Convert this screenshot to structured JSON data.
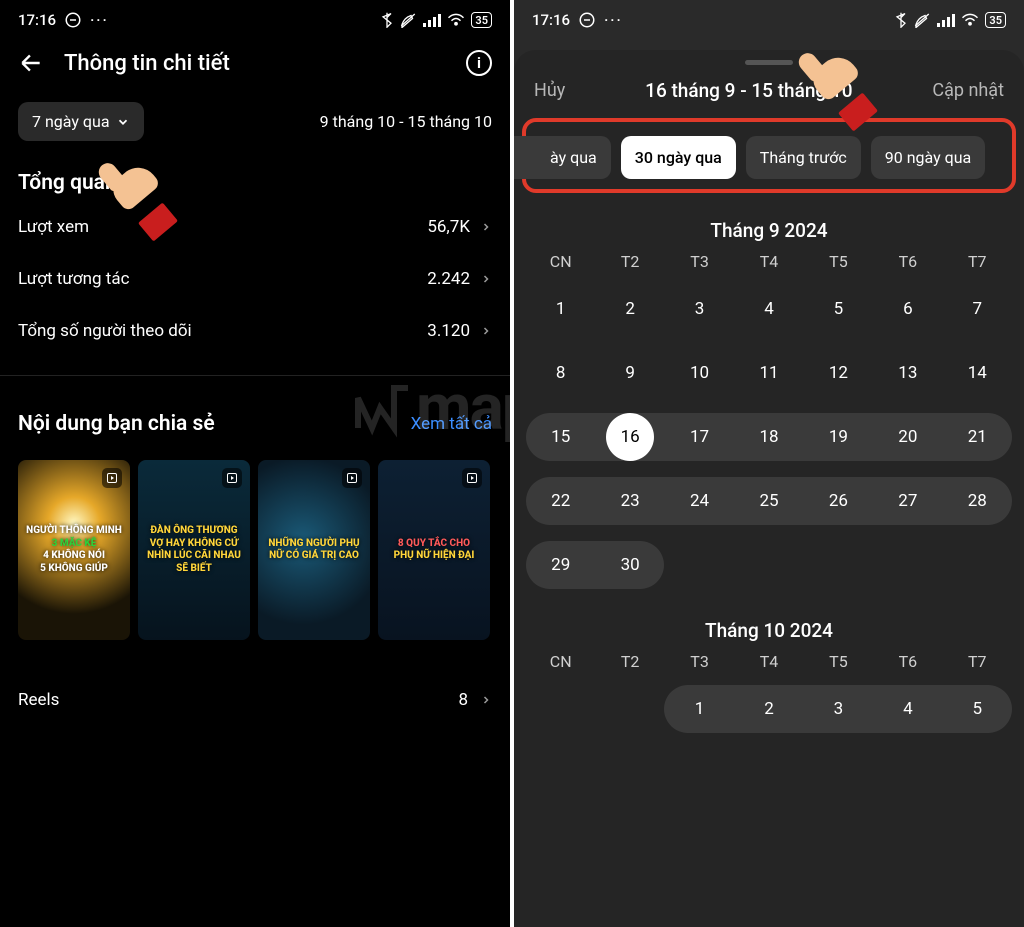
{
  "status": {
    "time": "17:16",
    "battery": "35"
  },
  "left": {
    "header_title": "Thông tin chi tiết",
    "range_chip": "7 ngày qua",
    "range_text": "9 tháng 10 - 15 tháng 10",
    "overview_title": "Tổng quan",
    "metrics": {
      "views_label": "Lượt xem",
      "views_value": "56,7K",
      "interactions_label": "Lượt tương tác",
      "interactions_value": "2.242",
      "followers_label": "Tổng số người theo dõi",
      "followers_value": "3.120"
    },
    "content_title": "Nội dung bạn chia sẻ",
    "see_all": "Xem tất cả",
    "thumbs": {
      "t1_l1": "NGƯỜI THÔNG MINH",
      "t1_l2": "3 MẶC KỆ",
      "t1_l3": "4 KHÔNG NÓI",
      "t1_l4": "5 KHÔNG GIÚP",
      "t2": "ĐÀN ÔNG THƯƠNG VỢ HAY KHÔNG CỨ NHÌN LÚC CÃI NHAU SẼ BIẾT",
      "t3": "NHỮNG NGƯỜI PHỤ NỮ CÓ GIÁ TRỊ CAO",
      "t4_l1": "8 QUY TẮC CHO",
      "t4_l2": "PHỤ NỮ HIỆN ĐẠI"
    },
    "reels_label": "Reels",
    "reels_value": "8"
  },
  "right": {
    "cancel": "Hủy",
    "range_title": "16 tháng 9 - 15 tháng 10",
    "update": "Cập nhật",
    "presets": {
      "p0": "ày qua",
      "p1": "30 ngày qua",
      "p2": "Tháng trước",
      "p3": "90 ngày qua"
    },
    "month1": "Tháng 9 2024",
    "month2": "Tháng 10 2024",
    "dow": {
      "d0": "CN",
      "d1": "T2",
      "d2": "T3",
      "d3": "T4",
      "d4": "T5",
      "d5": "T6",
      "d6": "T7"
    },
    "sep": {
      "r1": {
        "c0": "1",
        "c1": "2",
        "c2": "3",
        "c3": "4",
        "c4": "5",
        "c5": "6",
        "c6": "7"
      },
      "r2": {
        "c0": "8",
        "c1": "9",
        "c2": "10",
        "c3": "11",
        "c4": "12",
        "c5": "13",
        "c6": "14"
      },
      "r3": {
        "c0": "15",
        "c1": "16",
        "c2": "17",
        "c3": "18",
        "c4": "19",
        "c5": "20",
        "c6": "21"
      },
      "r4": {
        "c0": "22",
        "c1": "23",
        "c2": "24",
        "c3": "25",
        "c4": "26",
        "c5": "27",
        "c6": "28"
      },
      "r5": {
        "c0": "29",
        "c1": "30"
      }
    },
    "oct": {
      "r1": {
        "c2": "1",
        "c3": "2",
        "c4": "3",
        "c5": "4",
        "c6": "5"
      }
    }
  },
  "watermark": "mape"
}
